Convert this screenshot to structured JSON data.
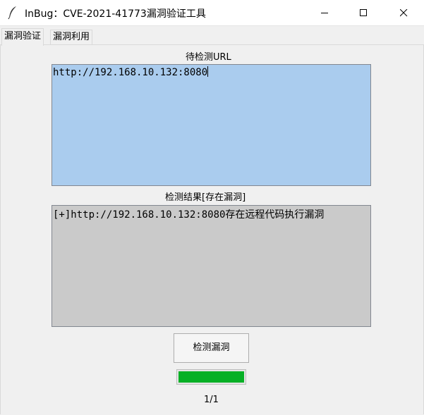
{
  "window": {
    "title": "InBug：CVE-2021-41773漏洞验证工具",
    "icon": "feather-icon",
    "controls": [
      "minimize-icon",
      "maximize-icon",
      "close-icon"
    ]
  },
  "tabs": [
    {
      "label": "漏洞验证",
      "active": true
    },
    {
      "label": "漏洞利用",
      "active": false
    }
  ],
  "verify": {
    "url_label": "待检测URL",
    "url_value": "http://192.168.10.132:8080",
    "result_label": "检测结果[存在漏洞]",
    "result_value": "[+]http://192.168.10.132:8080存在远程代码执行漏洞",
    "check_button": "检测漏洞",
    "progress_fraction": 1.0,
    "progress_color": "#06b025",
    "count": "1/1"
  },
  "colors": {
    "url_box_bg": "#aaccee",
    "result_box_bg": "#cacaca"
  }
}
